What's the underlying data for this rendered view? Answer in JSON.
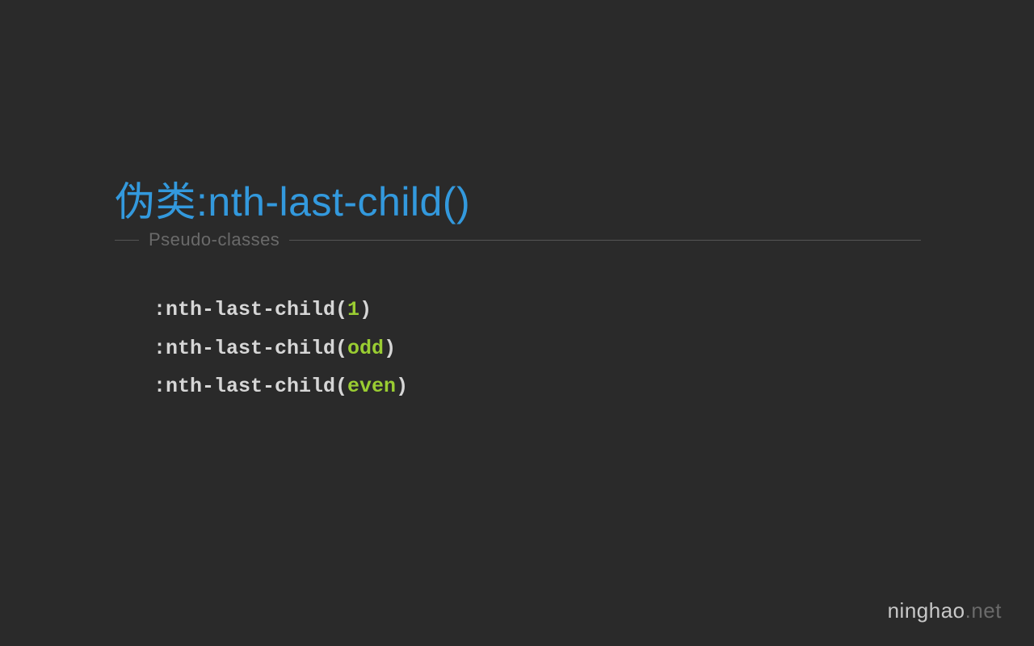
{
  "title": "伪类:nth-last-child()",
  "subtitle": "Pseudo-classes",
  "code": {
    "lines": [
      {
        "prefix": ":nth-last-child(",
        "arg": "1",
        "suffix": ")"
      },
      {
        "prefix": ":nth-last-child(",
        "arg": "odd",
        "suffix": ")"
      },
      {
        "prefix": ":nth-last-child(",
        "arg": "even",
        "suffix": ")"
      }
    ]
  },
  "watermark": {
    "brand": "ninghao",
    "domain": ".net"
  }
}
